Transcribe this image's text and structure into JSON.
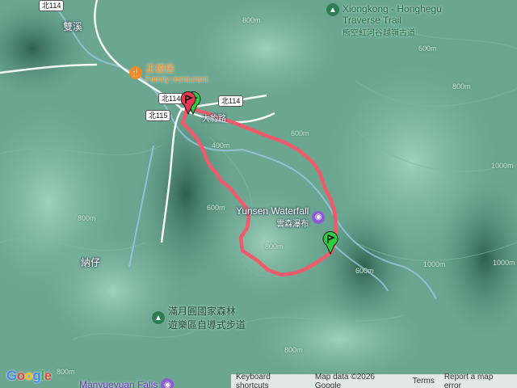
{
  "places": {
    "shuangxi": "雙溪",
    "nazi": "納仔",
    "restaurant_zh": "正德居",
    "restaurant_en": "Family restaurant",
    "waterfall_en": "Yunsen Waterfall",
    "waterfall_zh": "雲森瀑布",
    "forest_zh_1": "滿月圓國家森林",
    "forest_zh_2": "遊樂區自導式步道",
    "falls_en": "Manyueyuan Falls",
    "trail_en_1": "Xiongkong - Honghegu",
    "trail_en_2": "Traverse Trail",
    "trail_zh": "熊空紅河谷越嶺古道"
  },
  "roads": {
    "r114_top": "北114",
    "r114_a": "北114",
    "r114_b": "北114",
    "r115": "北115",
    "road_name": "大豹路"
  },
  "contours": [
    "600m",
    "400m",
    "600m",
    "800m",
    "800m",
    "600m",
    "800m",
    "1000m",
    "800m",
    "600m",
    "1000m",
    "800m",
    "800m",
    "1000m"
  ],
  "footer": {
    "google": "Google",
    "keyboard": "Keyboard shortcuts",
    "mapdata": "Map data ©2026 Google",
    "terms": "Terms",
    "report": "Report a map error"
  },
  "route_color": "#f05a6a",
  "start_flag_color": "#2ecc40",
  "end_flag_color": "#e8384f"
}
